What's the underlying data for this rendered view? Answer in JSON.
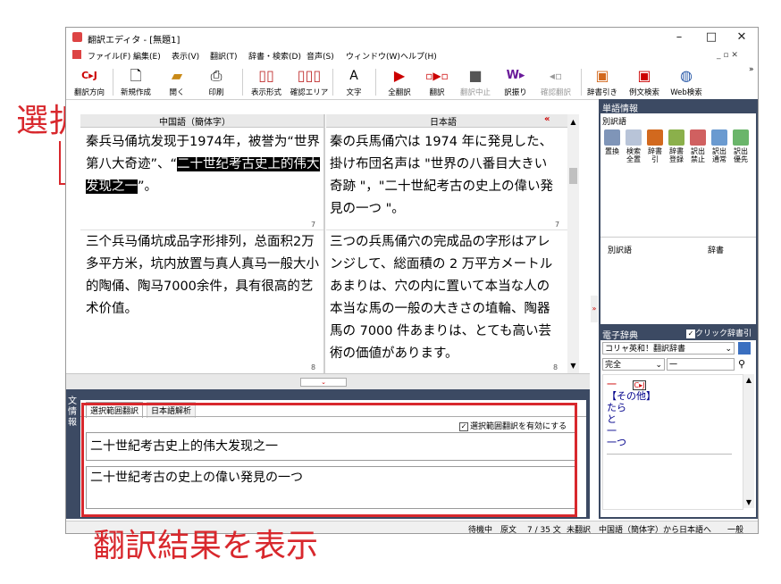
{
  "window": {
    "title": "翻訳エディタ - [無題1]",
    "minimize": "–",
    "maximize": "□",
    "close": "✕"
  },
  "menu": [
    "ファイル(F)",
    "編集(E)",
    "表示(V)",
    "翻訳(T)",
    "辞書・検索(D)",
    "音声(S)",
    "ウィンドウ(W)",
    "ヘルプ(H)"
  ],
  "toolbar": {
    "direction_icon": "C▸J",
    "direction": "翻訳方向",
    "new": "新規作成",
    "open": "開く",
    "print": "印刷",
    "display_format": "表示形式",
    "confirm_area": "確認エリア",
    "text": "文字",
    "translate_all": "全翻訳",
    "translate": "翻訳",
    "stop": "翻訳中止",
    "reverse": "訳振り",
    "confirm": "確認翻訳",
    "dict_lookup": "辞書引き",
    "example_search": "例文検索",
    "web_search": "Web検索"
  },
  "source_pane": {
    "header": "中国語（簡体字）",
    "sentence1_pre": "秦兵马俑坑发现于1974年，被誉为“世界第八大奇迹”、“",
    "sentence1_sel": "二十世纪考古史上的伟大发现之一",
    "sentence1_post": "”。",
    "num1": "7",
    "sentence2": "三个兵马俑坑成品字形排列，总面积2万多平方米，坑内放置与真人真马一般大小的陶俑、陶马7000余件，具有很高的艺术价值。",
    "num2": "8"
  },
  "target_pane": {
    "header": "日本語",
    "collapse": "«",
    "sentence1": "秦の兵馬俑穴は 1974 年に発見した、掛け布団名声は \"世界の八番目大きい奇跡 \"，\"二十世紀考古の史上の偉い発見の一つ \"。",
    "num1": "7",
    "sentence2": "三つの兵馬俑穴の完成品の字形はアレンジして、総面積の 2 万平方メートルあまりは、穴の内に置いて本当な人の本当な馬の一般の大きさの埴輪、陶器馬の 7000 件あまりは、とても高い芸術の価値があります。",
    "num2": "8"
  },
  "info_panel": {
    "side_label": "文情報",
    "tabs": [
      "選択範囲翻訳",
      "日本語解析"
    ],
    "checkbox_label": "選択範囲翻訳を有効にする",
    "checkbox_checked": true,
    "source_text": "二十世紀考古史上的伟大发现之一",
    "result_text": "二十世紀考古の史上の偉い発見の一つ"
  },
  "word_panel": {
    "title": "単語情報",
    "sub_title": "別訳語",
    "buttons": [
      "置換",
      "検索全置",
      "辞書引",
      "辞書登録",
      "訳出禁止",
      "訳出通常",
      "訳出優先"
    ],
    "col_alt": "別訳語",
    "col_dict": "辞書",
    "edict_label": "電子辞典",
    "click_dict": "クリック辞書引",
    "dict_name": "コリャ英和！翻訳辞書",
    "match_mode": "完全",
    "search_value": "一",
    "entries": [
      "一",
      "【その他】",
      "たら",
      "と",
      "一",
      "一つ"
    ],
    "badge": "C▸J"
  },
  "status_bar": [
    "待機中",
    "原文",
    "7 / 35 文",
    "未翻訳",
    "中国語（簡体字）から日本語へ",
    "一般"
  ],
  "annotations": {
    "selection": "選択範囲",
    "result": "翻訳結果を表示"
  },
  "colors": {
    "annotation_red": "#d8282d",
    "panel_blue": "#3c4a63",
    "selection_black": "#000000"
  }
}
